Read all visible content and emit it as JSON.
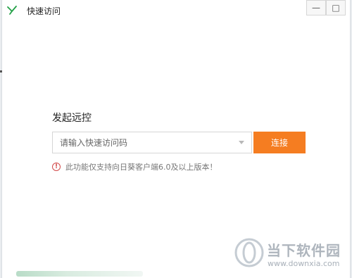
{
  "window": {
    "title": "快速访问",
    "minimize_icon": "minimize-icon",
    "maximize_icon": "maximize-icon"
  },
  "remote": {
    "section_title": "发起远控",
    "code_input": {
      "placeholder": "请输入快速访问码",
      "value": ""
    },
    "connect_label": "连接",
    "notice": "此功能仅支持向日葵客户端6.0及以上版本！"
  },
  "watermark": {
    "name": "当下软件园",
    "url": "www.downxia.com"
  },
  "colors": {
    "accent": "#f57d21",
    "app_icon": "#22a046",
    "notice_icon": "#d24a4a"
  }
}
